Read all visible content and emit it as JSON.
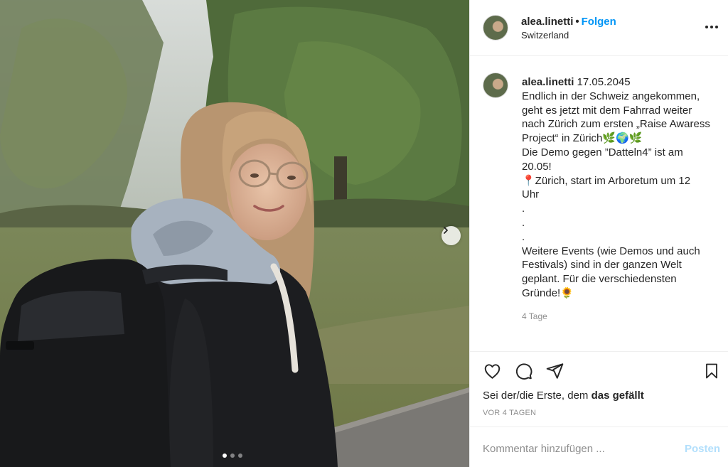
{
  "post": {
    "username": "alea.linetti",
    "follow_label": "Folgen",
    "separator": "•",
    "location": "Switzerland",
    "more_icon": "more-horizontal-icon"
  },
  "caption": {
    "username": "alea.linetti",
    "date": "17.05.2045",
    "lines": [
      "Endlich in der Schweiz angekommen,",
      "geht es jetzt mit dem Fahrrad weiter",
      "nach Zürich zum ersten „Raise Awaress",
      "Project“ in Zürich🌿🌍🌿",
      "Die Demo gegen ”Datteln4” ist am",
      "20.05!",
      "📍Zürich, start im Arboretum um 12",
      "Uhr",
      ".",
      ".",
      ".",
      "Weitere Events (wie Demos und auch",
      "Festivals) sind in der ganzen Welt",
      "geplant. Für die verschiedensten",
      "Gründe!🌻"
    ],
    "time_ago": "4 Tage"
  },
  "actions": {
    "like_icon": "heart-icon",
    "comment_icon": "comment-icon",
    "share_icon": "share-icon",
    "save_icon": "bookmark-icon"
  },
  "likes": {
    "prefix": "Sei der/die Erste, dem ",
    "bold": "das gefällt"
  },
  "posted": "VOR 4 TAGEN",
  "comment": {
    "placeholder": "Kommentar hinzufügen ...",
    "post_label": "Posten"
  },
  "carousel": {
    "count": 3,
    "active": 0,
    "next_icon": "chevron-right-icon"
  },
  "colors": {
    "link": "#0095f6",
    "post_disabled": "#b2dffc",
    "meta": "#8e8e8e",
    "text": "#262626"
  }
}
